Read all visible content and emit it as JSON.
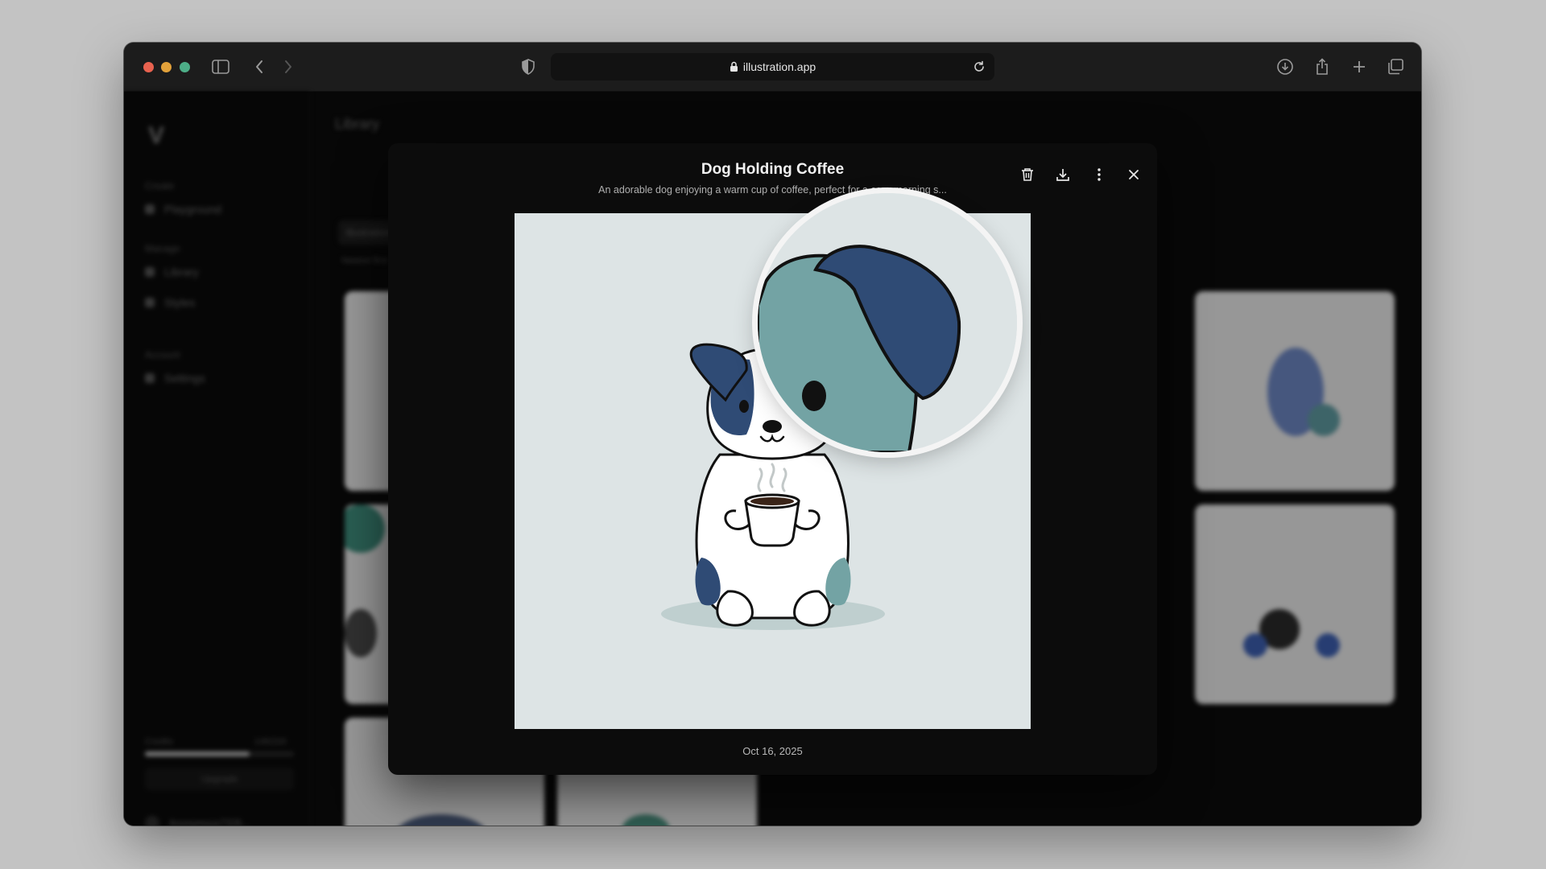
{
  "browser": {
    "url": "illustration.app"
  },
  "sidebar": {
    "sections": [
      "Create",
      "Manage",
      "Account"
    ],
    "items": [
      {
        "label": "Playground",
        "icon": "sparkle-icon"
      },
      {
        "label": "Library",
        "icon": "library-icon"
      },
      {
        "label": "Styles",
        "icon": "palette-icon"
      },
      {
        "label": "Settings",
        "icon": "gear-icon"
      }
    ],
    "credits_label": "Credits",
    "credits_value": "148/200",
    "credits_fraction": 0.7,
    "upgrade_label": "Upgrade",
    "user_label": "Anonymous7326..."
  },
  "main": {
    "title": "Library",
    "filter_label": "Illustrations",
    "sort_label": "Newest first"
  },
  "modal": {
    "title": "Dog Holding Coffee",
    "description": "An adorable dog enjoying a warm cup of coffee, perfect for a cozy morning s...",
    "date": "Oct 16, 2025",
    "actions": {
      "delete": "trash-icon",
      "download": "download-icon",
      "more": "more-vertical-icon",
      "close": "close-icon"
    }
  },
  "colors": {
    "image_bg": "#dde4e5",
    "dog_navy": "#2f4b75",
    "dog_teal": "#73a3a4",
    "modal_bg": "#0c0c0c"
  }
}
